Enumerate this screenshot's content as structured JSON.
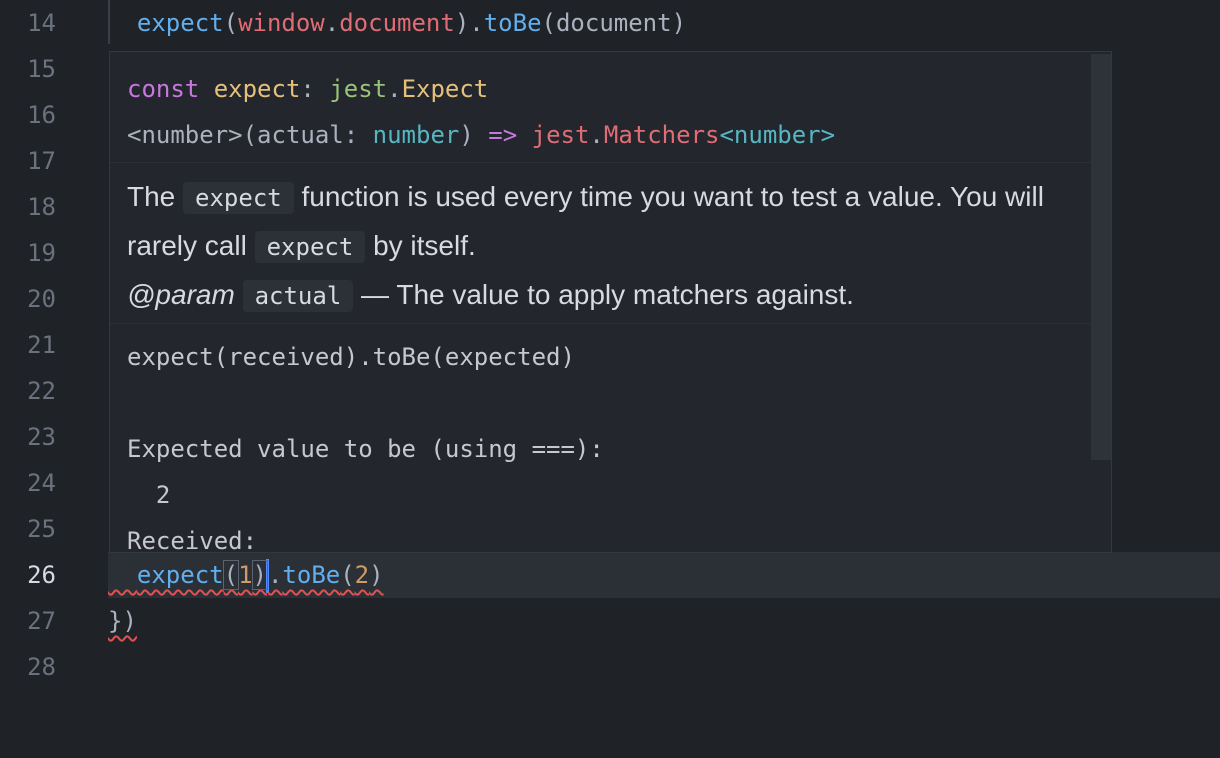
{
  "gutter": {
    "line_numbers": [
      "14",
      "15",
      "16",
      "17",
      "18",
      "19",
      "20",
      "21",
      "22",
      "23",
      "24",
      "25",
      "26",
      "27",
      "28"
    ],
    "active_line": "26"
  },
  "code": {
    "line14": {
      "fn": "expect",
      "arg_obj": "window",
      "arg_prop": "document",
      "method": "toBe",
      "arg": "document"
    },
    "line26": {
      "fn": "expect",
      "arg": "1",
      "method": "toBe",
      "expected": "2"
    },
    "line27": "})"
  },
  "hover": {
    "signature": {
      "keyword": "const",
      "name": "expect",
      "type_ns": "jest",
      "type_name": "Expect",
      "generic": "<number>",
      "param": "actual",
      "param_type": "number",
      "arrow": "=>",
      "ret_ns": "jest",
      "ret_name": "Matchers",
      "ret_generic": "<number>"
    },
    "doc": {
      "p1_a": "The ",
      "p1_code": "expect",
      "p1_b": " function is used every time you want to test a value. You will rarely call ",
      "p1_code2": "expect",
      "p1_c": " by itself.",
      "param_tag": "@param",
      "param_code": "actual",
      "param_desc": " — The value to apply matchers against."
    },
    "preview_lines": [
      "expect(received).toBe(expected)",
      "",
      "Expected value to be (using ===):",
      "  2",
      "Received:"
    ]
  }
}
